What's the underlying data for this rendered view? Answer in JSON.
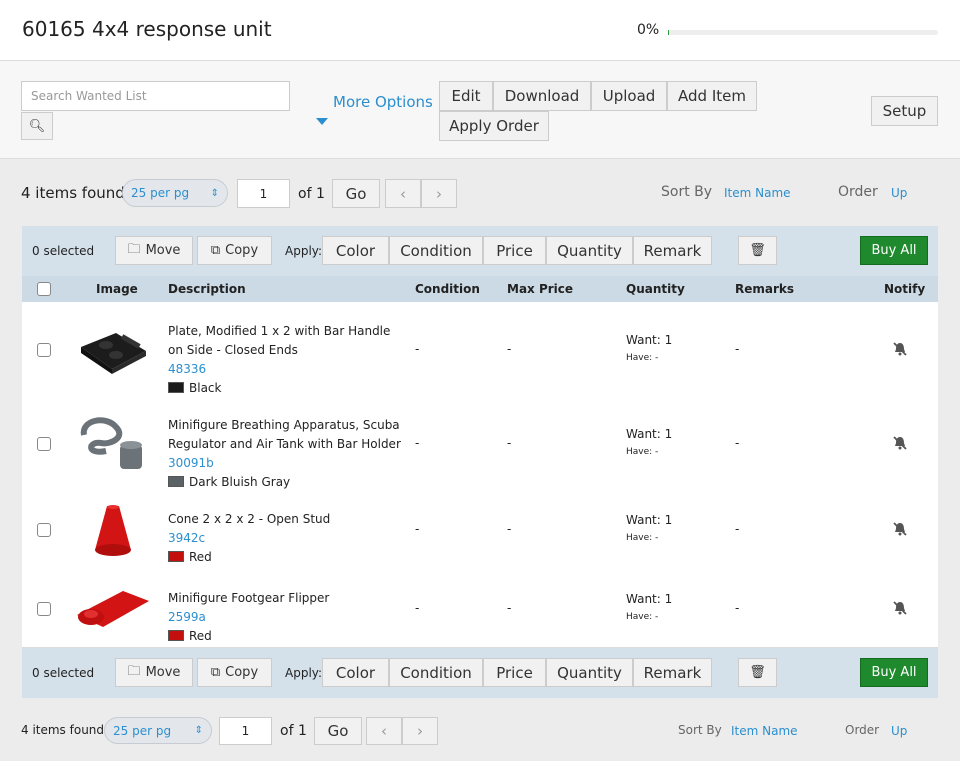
{
  "header": {
    "title": "60165 4x4 response unit",
    "progress_label": "0%",
    "progress": 0
  },
  "toolbar": {
    "search_placeholder": "Search Wanted List",
    "more_options": "More Options",
    "edit": "Edit",
    "download": "Download",
    "upload": "Upload",
    "add_item": "Add Item",
    "apply_order": "Apply Order",
    "setup": "Setup"
  },
  "pagination": {
    "found": "4 items found",
    "per_page": "25 per pg",
    "page": "1",
    "of": "of 1",
    "go": "Go",
    "prev": "‹",
    "next": "›",
    "sort_by": "Sort By",
    "sort_value": "Item Name",
    "order": "Order",
    "order_value": "Up"
  },
  "actions": {
    "selected": "0 selected",
    "move": "Move",
    "copy": "Copy",
    "apply": "Apply:",
    "color": "Color",
    "condition": "Condition",
    "price": "Price",
    "quantity": "Quantity",
    "remark": "Remark",
    "buy_all": "Buy All"
  },
  "columns": [
    "Image",
    "Description",
    "Condition",
    "Max Price",
    "Quantity",
    "Remarks",
    "Notify"
  ],
  "items": [
    {
      "name": "Plate, Modified 1 x 2 with Bar Handle on Side - Closed Ends",
      "id": "48336",
      "color": "Black",
      "swatch": "#1b1b1b",
      "condition": "-",
      "max_price": "-",
      "want": "Want: 1",
      "have": "Have: -",
      "remarks": "-"
    },
    {
      "name": "Minifigure Breathing Apparatus, Scuba Regulator and Air Tank with Bar Holder",
      "id": "30091b",
      "color": "Dark Bluish Gray",
      "swatch": "#5b6266",
      "condition": "-",
      "max_price": "-",
      "want": "Want: 1",
      "have": "Have: -",
      "remarks": "-"
    },
    {
      "name": "Cone 2 x 2 x 2 - Open Stud",
      "id": "3942c",
      "color": "Red",
      "swatch": "#c40f0f",
      "condition": "-",
      "max_price": "-",
      "want": "Want: 1",
      "have": "Have: -",
      "remarks": "-"
    },
    {
      "name": "Minifigure Footgear Flipper",
      "id": "2599a",
      "color": "Red",
      "swatch": "#c40f0f",
      "condition": "-",
      "max_price": "-",
      "want": "Want: 1",
      "have": "Have: -",
      "remarks": "-"
    }
  ]
}
